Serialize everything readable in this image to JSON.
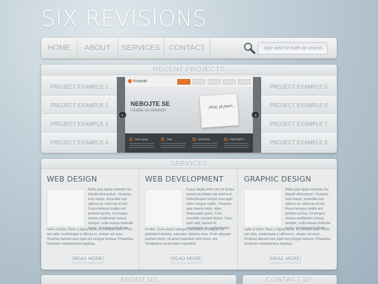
{
  "site": {
    "logo": "SIX REVISIONS"
  },
  "nav": {
    "items": [
      "HOME",
      "ABOUT",
      "SERVICES",
      "CONTACT"
    ],
    "search_placeholder": "type and hit enter to search"
  },
  "projects": {
    "title": "RECENT PROJECTS",
    "left": [
      "PROJECT EXAMPLE 1",
      "PROJECT EXAMPLE 2",
      "PROJECT EXAMPLE 3",
      "PROJECT EXAMPLE 4"
    ],
    "right": [
      "PROJECT EXAMPLE 5",
      "PROJECT EXAMPLE 6",
      "PROJECT EXAMPLE 7",
      "PROJECT EXAMPLE 8"
    ],
    "slide": {
      "brand": "Kompakt",
      "headline": "NEBOJTE SE",
      "subline": "Ukážte se ostatním",
      "sign_text": "Ahoj, já jsem...",
      "features": [
        "REKLAMA",
        "TISK",
        "GRAFIKA",
        "PŘEDMĚTY"
      ],
      "prev": "‹",
      "next": "›"
    }
  },
  "services": {
    "title": "SERVICES",
    "columns": [
      {
        "heading": "WEB DESIGN",
        "side_text": "Nulla quis ligula molestie dui blandit elementum. Vivamus erat neque, imperdiet non ultrices at, vehicula id nisl. Fusce tempus mattis nisl pretium lacinia. Ut tempus, massa vestibulum cursus semper, nulla massa molestie turpis, id malesuada libero",
        "full_text": "nulla ut dolor. Nunc a ligula lacus, et tristique ante. Proin nisi odio, scelerisque a ultrices in, ornare vel nunc. Vivamus laoreet sem eget dui congue tempus. Phasellus hendrerit condimentum dapibus.",
        "button": "READ MORE"
      },
      {
        "heading": "WEB DEVELOPMENT",
        "side_text": "Fusce dapib enim vel est lectus laoreet at phatra nisl eleif end. Pellentesque tempor erat eget dolor congue mattis. Vivamus quis mauris enim, vitae malesuada quam. Cras convallis suscipit dictum. Nunc ante velit, laoreet et scelerisque eu, pellentesque",
        "full_text": "id nibh. Cum sociis natoque penatibus et magnis dis parturient montes, nascetur ridiculus mus. Proin aliquam pretium tortor, sit amet imperdiet velit tincid- unt. Vestibulum consectetur imperdiet.",
        "button": "READ MORE"
      },
      {
        "heading": "GRAPHIC DESIGN",
        "side_text": "Nulla quis ligula molestie dui blandit elementum. Vivamus erat neque, imperdiet non ultrices at, vehicula id nisl. Fusce tempus mattis nisl pretium lacinia. Ut tempus, massa vestibulum cursus semper, nulla massa molestie turpis, id malesuada libero",
        "full_text": "nulla ut dolor. Nunc a ligula lacus, et tristique ante. Proin nisi odio, scelerisque a ultrices in, ornare vel nunc. Vivamus laoreet sem eget dui congue tempus. Phasellus hendrerit condimentum dapibus.",
        "button": "READ MORE"
      }
    ]
  },
  "about": {
    "title": "ABOUT US"
  },
  "contact": {
    "title": "CONTACT US"
  },
  "colors": {
    "accent": "#e8732c",
    "panel": "#e9ebec",
    "muted_text": "#a6abaf"
  }
}
